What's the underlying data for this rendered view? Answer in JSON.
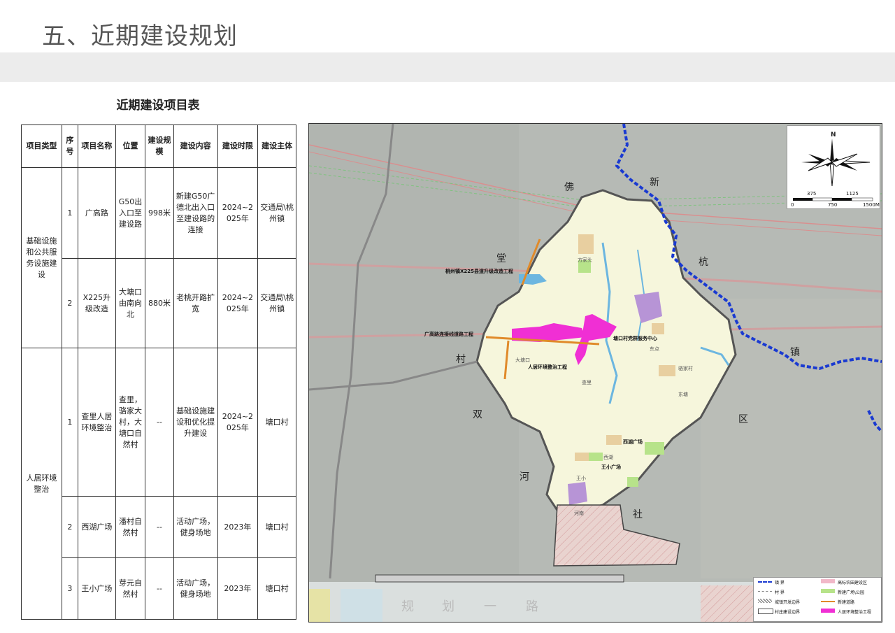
{
  "page_title": "五、近期建设规划",
  "table": {
    "title": "近期建设项目表",
    "headers": [
      "项目类型",
      "序号",
      "项目名称",
      "位置",
      "建设规模",
      "建设内容",
      "建设时限",
      "建设主体"
    ],
    "groups": [
      {
        "type": "基础设施和公共服务设施建设",
        "rows": [
          {
            "no": "1",
            "name": "广高路",
            "location": "G50出入口至建设路",
            "scale": "998米",
            "content": "新建G50广德北出入口至建设路的连接",
            "period": "2024~2025年",
            "owner": "交通局\\桃州镇"
          },
          {
            "no": "2",
            "name": "X225升级改造",
            "location": "大塘口由南向北",
            "scale": "880米",
            "content": "老桃开路扩宽",
            "period": "2024~2025年",
            "owner": "交通局\\桃州镇"
          }
        ]
      },
      {
        "type": "人居环境整治",
        "rows": [
          {
            "no": "1",
            "name": "查里人居环境整治",
            "location": "查里，骆家大村，大塘口自然村",
            "scale": "--",
            "content": "基础设施建设和优化提升建设",
            "period": "2024~2025年",
            "owner": "塘口村"
          },
          {
            "no": "2",
            "name": "西湖广场",
            "location": "潘村自然村",
            "scale": "--",
            "content": "活动广场，健身场地",
            "period": "2023年",
            "owner": "塘口村"
          },
          {
            "no": "3",
            "name": "王小广场",
            "location": "芽元自然村",
            "scale": "--",
            "content": "活动广场，健身场地",
            "period": "2023年",
            "owner": "塘口村"
          }
        ]
      }
    ]
  },
  "map": {
    "region_labels": {
      "fo": "佛",
      "tang": "堂",
      "cun": "村",
      "shuang": "双",
      "he": "河",
      "she": "社",
      "xin": "新",
      "hang": "杭",
      "zhen": "镇",
      "qu": "区"
    },
    "project_labels": {
      "x225": "桃州镇X225县道升级改造工程",
      "guanggao": "广高路连接线道路工程",
      "party_center": "塘口村党群服务中心",
      "env": "人居环境整治工程",
      "xihu": "西湖广场",
      "wangxiao": "王小广场"
    },
    "village_labels": {
      "fangjia": "方家头",
      "dashu": "大塘口",
      "chali": "查里",
      "luojia": "骆家村",
      "dongdian": "东点",
      "xihu_v": "西湖",
      "wangxiao_v": "王小",
      "henan": "河南",
      "dongtang": "东塘"
    },
    "bottom_road_text": [
      "规",
      "划",
      "一",
      "路"
    ],
    "compass": {
      "north": "N"
    },
    "scale_bar": {
      "ticks_top": [
        "375",
        "1125"
      ],
      "ticks_bottom": [
        "0",
        "750",
        "1500M"
      ]
    },
    "legend": [
      {
        "label": "镇 界",
        "color": "#1a3ad1",
        "style": "town-boundary"
      },
      {
        "label": "高标农田建设区",
        "color": "#f1b8c8",
        "style": "hatch-pink"
      },
      {
        "label": "村 界",
        "color": "#888888",
        "style": "village-boundary"
      },
      {
        "label": "新建广场\\公园",
        "color": "#b7e38a",
        "style": "fill"
      },
      {
        "label": "城镇开发边界",
        "color": "#777777",
        "style": "hatch"
      },
      {
        "label": "新建道路",
        "color": "#e08a2a",
        "style": "line"
      },
      {
        "label": "村庄建设边界",
        "color": "#555555",
        "style": "box"
      },
      {
        "label": "人居环境整治工程",
        "color": "#f02fd4",
        "style": "fill"
      }
    ]
  }
}
